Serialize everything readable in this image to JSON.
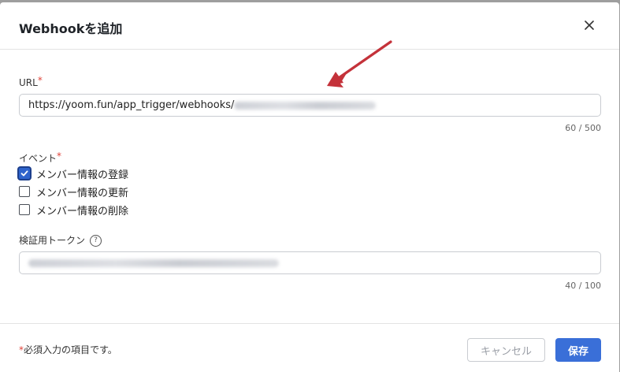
{
  "dialog": {
    "title": "Webhookを追加"
  },
  "url_field": {
    "label": "URL",
    "required_mark": "*",
    "value_prefix": "https://yoom.fun/app_trigger/webhooks/",
    "counter": "60 / 500"
  },
  "events": {
    "label": "イベント",
    "required_mark": "*",
    "options": [
      {
        "label": "メンバー情報の登録",
        "checked": true
      },
      {
        "label": "メンバー情報の更新",
        "checked": false
      },
      {
        "label": "メンバー情報の削除",
        "checked": false
      }
    ]
  },
  "token_field": {
    "label": "検証用トークン",
    "help_icon": "?",
    "counter": "40 / 100"
  },
  "footer": {
    "required_mark": "*",
    "required_note": "必須入力の項目です。",
    "cancel_label": "キャンセル",
    "save_label": "保存"
  },
  "colors": {
    "accent": "#3a6fd8",
    "required": "#e0443a",
    "annotation_arrow": "#c4323a"
  }
}
